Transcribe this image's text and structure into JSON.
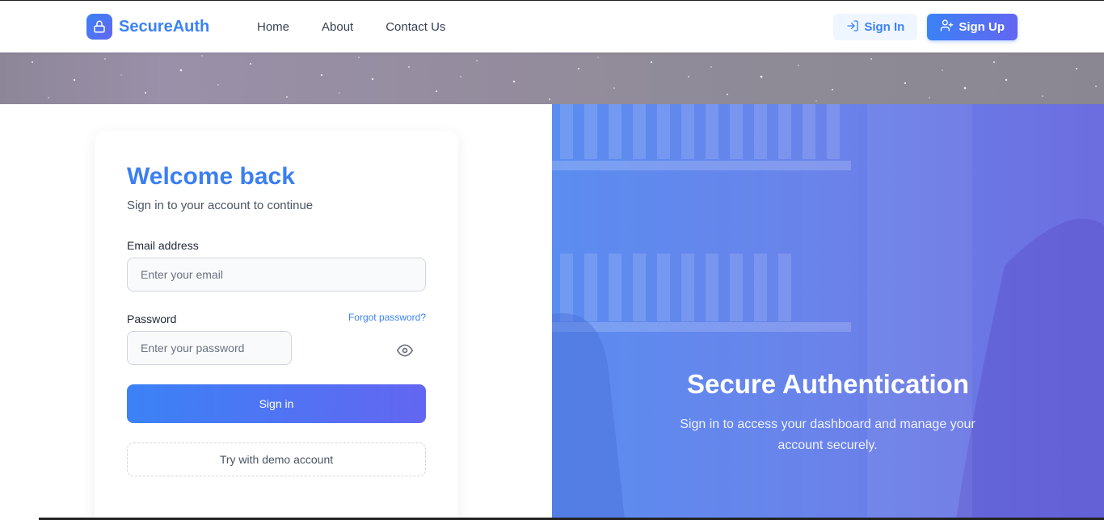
{
  "brand": {
    "name": "SecureAuth",
    "logo_icon": "lock-icon"
  },
  "nav": {
    "links": [
      {
        "label": "Home"
      },
      {
        "label": "About"
      },
      {
        "label": "Contact Us"
      }
    ],
    "sign_in_label": "Sign In",
    "sign_up_label": "Sign Up"
  },
  "login": {
    "title": "Welcome back",
    "subtitle": "Sign in to your account to continue",
    "email_label": "Email address",
    "email_placeholder": "Enter your email",
    "email_value": "",
    "password_label": "Password",
    "password_placeholder": "Enter your password",
    "password_value": "",
    "forgot_label": "Forgot password?",
    "submit_label": "Sign in",
    "demo_label": "Try with demo account"
  },
  "hero": {
    "title": "Secure Authentication",
    "text": "Sign in to access your dashboard and manage your account securely."
  },
  "colors": {
    "accent": "#3b82f6",
    "accent2": "#6366f1",
    "panel": "#6a83ea"
  }
}
